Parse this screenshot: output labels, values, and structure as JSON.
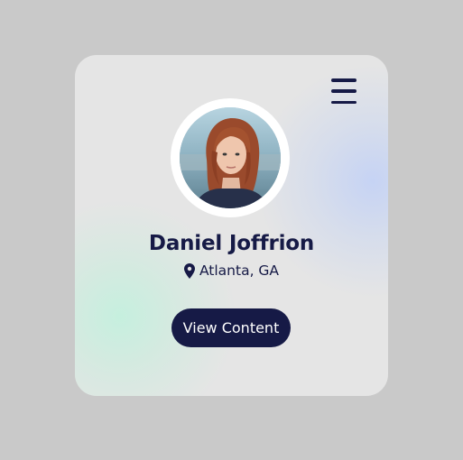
{
  "profile": {
    "name": "Daniel Joffrion",
    "location": "Atlanta, GA",
    "avatar_icon": "person-portrait-photo",
    "location_icon": "map-pin-icon"
  },
  "actions": {
    "primary_label": "View Content",
    "menu_icon": "hamburger-menu-icon"
  },
  "colors": {
    "background": "#c9c9c9",
    "card": "#e5e5e5",
    "accent": "#161a46",
    "glow_blue": "#c4d2f5",
    "glow_green": "#c4f0de"
  }
}
